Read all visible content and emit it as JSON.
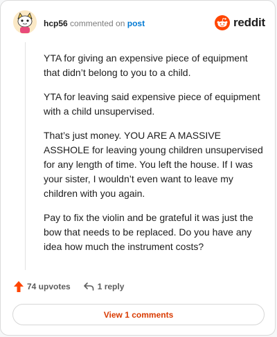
{
  "header": {
    "username": "hcp56",
    "action_text": "commented on",
    "post_link": "post",
    "brand": "reddit"
  },
  "comment": {
    "paragraphs": [
      "YTA for giving an expensive piece of equipment that didn’t belong to you to a child.",
      "YTA for leaving said expensive piece of equipment with a child unsupervised.",
      "That’s just money. YOU ARE A MASSIVE ASSHOLE for leaving young children unsupervised for any length of time. You left the house. If I was your sister, I wouldn’t even want to leave my children with you again.",
      "Pay to fix the violin and be grateful it was just the bow that needs to be replaced. Do you have any idea how much the instrument costs?"
    ]
  },
  "actions": {
    "upvotes": "74 upvotes",
    "replies": "1 reply",
    "view_comments": "View 1 comments"
  },
  "icons": {
    "avatar": "snoo-avatar-icon",
    "brand": "reddit-snoo-icon",
    "upvote": "upvote-arrow-icon",
    "reply": "reply-arrow-icon"
  },
  "colors": {
    "brand_orange": "#ff4500",
    "upvote_active": "#ff4500",
    "link_blue": "#0079d3",
    "view_button_text": "#d93a00"
  }
}
